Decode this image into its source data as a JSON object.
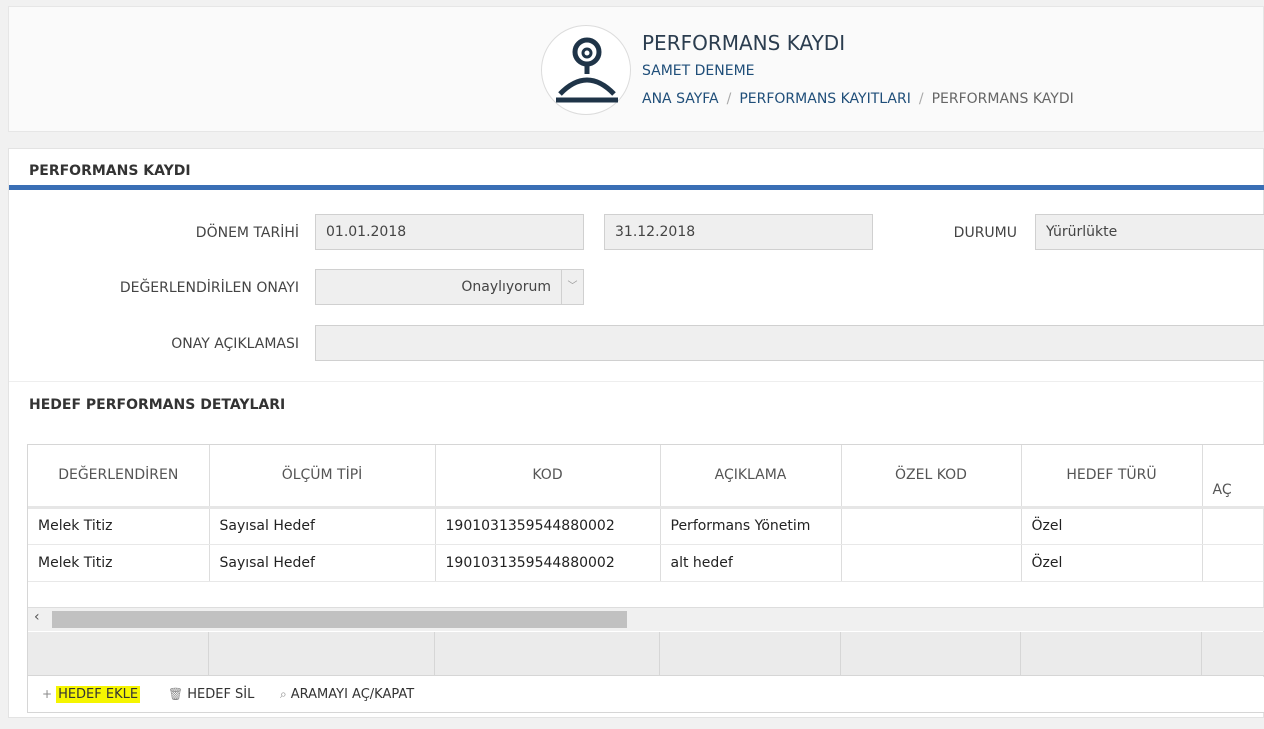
{
  "header": {
    "title": "PERFORMANS KAYDI",
    "user": "SAMET DENEME",
    "breadcrumb": [
      "ANA SAYFA",
      "PERFORMANS KAYITLARI",
      "PERFORMANS KAYDI"
    ]
  },
  "form": {
    "panel_title": "PERFORMANS KAYDI",
    "period_label": "DÖNEM TARİHİ",
    "period_start": "01.01.2018",
    "period_end": "31.12.2018",
    "status_label": "DURUMU",
    "status_value": "Yürürlükte",
    "approval_label": "DEĞERLENDİRİLEN ONAYI",
    "approval_value": "Onaylıyorum",
    "approval_note_label": "ONAY AÇIKLAMASI",
    "approval_note_value": ""
  },
  "targets": {
    "section_title": "HEDEF PERFORMANS DETAYLARI",
    "columns": [
      "DEĞERLENDİREN",
      "ÖLÇÜM TİPİ",
      "KOD",
      "AÇIKLAMA",
      "ÖZEL KOD",
      "HEDEF TÜRÜ",
      "AÇ"
    ],
    "rows": [
      [
        "Melek  Titiz",
        "Sayısal Hedef",
        "1901031359544880002",
        "Performans Yönetim",
        "",
        "Özel",
        ""
      ],
      [
        "Melek  Titiz",
        "Sayısal Hedef",
        "1901031359544880002",
        "alt hedef",
        "",
        "Özel",
        ""
      ]
    ],
    "scroll_left_icon": "‹",
    "toolbar": {
      "add_icon": "plus-icon",
      "add_label": "HEDEF EKLE",
      "delete_icon": "trash-icon",
      "delete_label": "HEDEF SİL",
      "search_icon": "search-icon",
      "search_label": "ARAMAYI AÇ/KAPAT"
    }
  },
  "colors": {
    "accent": "#3a6fb5",
    "link": "#1f4e79",
    "highlight": "#f5f500"
  }
}
